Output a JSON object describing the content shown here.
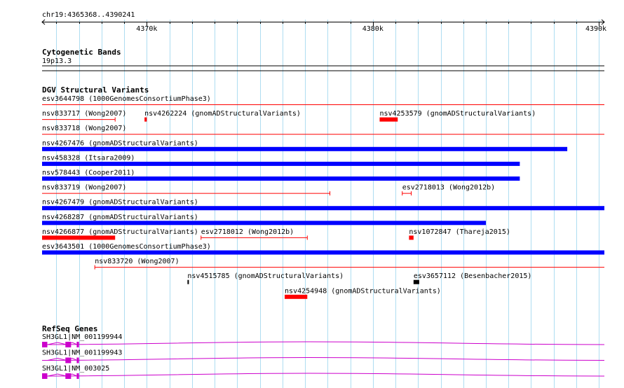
{
  "ruler": {
    "location": "chr19:4365368..4390241",
    "ticks": [
      {
        "pos": 4370000,
        "label": "4370k"
      },
      {
        "pos": 4380000,
        "label": "4380k"
      },
      {
        "pos": 4390000,
        "label": "4390k"
      }
    ]
  },
  "tracks": {
    "cytoband": {
      "title": "Cytogenetic Bands",
      "band": "19p13.3"
    },
    "dgv": {
      "title": "DGV Structural Variants",
      "colors": {
        "gain": "#0000ff",
        "loss": "#ff0000",
        "complex": "#000000"
      },
      "features": [
        {
          "label": "esv3644798 (1000GenomesConsortiumPhase3)",
          "start": 4365368,
          "end": 4390241,
          "row": 0,
          "type": "loss",
          "shape": "line"
        },
        {
          "label": "nsv833717 (Wong2007)",
          "start": 4365368,
          "end": 4368600,
          "row": 1,
          "type": "loss",
          "shape": "line"
        },
        {
          "label": "nsv4262224 (gnomADStructuralVariants)",
          "start": 4369900,
          "end": 4370000,
          "row": 1,
          "type": "loss",
          "shape": "box"
        },
        {
          "label": "nsv4253579 (gnomADStructuralVariants)",
          "start": 4380300,
          "end": 4381100,
          "row": 1,
          "type": "loss",
          "shape": "box"
        },
        {
          "label": "nsv833718 (Wong2007)",
          "start": 4365368,
          "end": 4390241,
          "row": 2,
          "type": "loss",
          "shape": "line"
        },
        {
          "label": "nsv4267476 (gnomADStructuralVariants)",
          "start": 4365368,
          "end": 4388600,
          "row": 3,
          "type": "gain",
          "shape": "box"
        },
        {
          "label": "nsv458328 (Itsara2009)",
          "start": 4365368,
          "end": 4386500,
          "row": 4,
          "type": "gain",
          "shape": "box"
        },
        {
          "label": "nsv578443 (Cooper2011)",
          "start": 4365368,
          "end": 4386500,
          "row": 5,
          "type": "gain",
          "shape": "box"
        },
        {
          "label": "nsv833719 (Wong2007)",
          "start": 4365368,
          "end": 4378100,
          "row": 6,
          "type": "loss",
          "shape": "line"
        },
        {
          "label": "esv2718013 (Wong2012b)",
          "start": 4381300,
          "end": 4381700,
          "row": 6,
          "type": "loss",
          "shape": "line"
        },
        {
          "label": "nsv4267479 (gnomADStructuralVariants)",
          "start": 4365368,
          "end": 4390241,
          "row": 7,
          "type": "gain",
          "shape": "box"
        },
        {
          "label": "nsv4268287 (gnomADStructuralVariants)",
          "start": 4365368,
          "end": 4385000,
          "row": 8,
          "type": "gain",
          "shape": "box"
        },
        {
          "label": "nsv4266877 (gnomADStructuralVariants)",
          "start": 4365368,
          "end": 4368600,
          "row": 9,
          "type": "loss",
          "shape": "box"
        },
        {
          "label": "esv2718012 (Wong2012b)",
          "start": 4372400,
          "end": 4377100,
          "row": 9,
          "type": "loss",
          "shape": "line"
        },
        {
          "label": "nsv1072847 (Thareja2015)",
          "start": 4381600,
          "end": 4381800,
          "row": 9,
          "type": "loss",
          "shape": "box"
        },
        {
          "label": "esv3643501 (1000GenomesConsortiumPhase3)",
          "start": 4365368,
          "end": 4390241,
          "row": 10,
          "type": "gain",
          "shape": "box"
        },
        {
          "label": "nsv833720 (Wong2007)",
          "start": 4367700,
          "end": 4390241,
          "row": 11,
          "type": "loss",
          "shape": "line"
        },
        {
          "label": "nsv4515785 (gnomADStructuralVariants)",
          "start": 4371800,
          "end": 4371860,
          "row": 12,
          "type": "complex",
          "shape": "box"
        },
        {
          "label": "esv3657112 (Besenbacher2015)",
          "start": 4381800,
          "end": 4382050,
          "row": 12,
          "type": "complex",
          "shape": "box"
        },
        {
          "label": "nsv4254948 (gnomADStructuralVariants)",
          "start": 4376100,
          "end": 4377100,
          "row": 13,
          "type": "loss",
          "shape": "box"
        }
      ]
    },
    "refseq": {
      "title": "RefSeq Genes",
      "color": "#cc00cc",
      "genes": [
        {
          "label": "SH3GL1|NM_001199944",
          "exons": [
            [
              4365368,
              4365600
            ],
            [
              4366400,
              4366650
            ],
            [
              4366900,
              4367000
            ]
          ]
        },
        {
          "label": "SH3GL1|NM_001199943",
          "exons": [
            [
              4366400,
              4366650
            ],
            [
              4366900,
              4367000
            ]
          ]
        },
        {
          "label": "SH3GL1|NM_003025",
          "exons": [
            [
              4365368,
              4365600
            ],
            [
              4366400,
              4366650
            ],
            [
              4366900,
              4367000
            ]
          ]
        }
      ]
    }
  }
}
